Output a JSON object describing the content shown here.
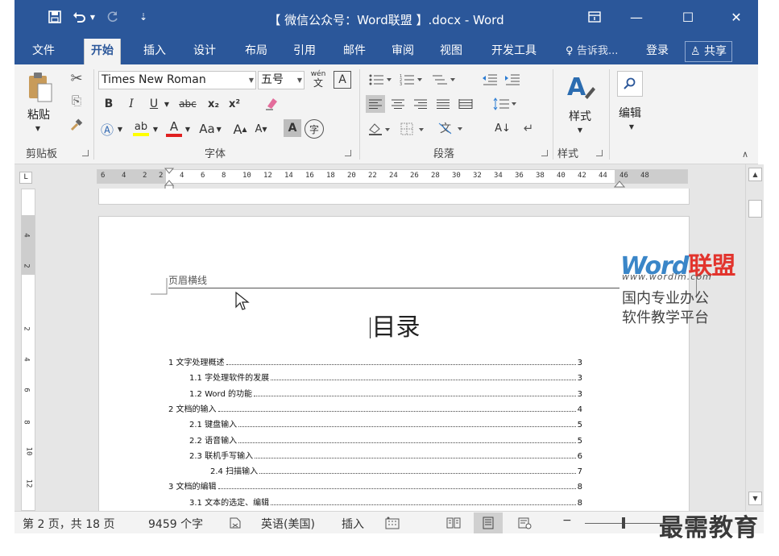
{
  "titlebar": {
    "title": "【 微信公众号：Word联盟 】.docx - Word",
    "save_icon": "save-icon",
    "undo_icon": "undo-icon",
    "redo_icon": "redo-icon",
    "restore_icon": "ribbon-display-icon",
    "minimize": "—",
    "maximize": "☐",
    "close": "✕",
    "bg": "#2b579a"
  },
  "tabs": [
    {
      "label": "文件"
    },
    {
      "label": "开始"
    },
    {
      "label": "插入"
    },
    {
      "label": "设计"
    },
    {
      "label": "布局"
    },
    {
      "label": "引用"
    },
    {
      "label": "邮件"
    },
    {
      "label": "审阅"
    },
    {
      "label": "视图"
    },
    {
      "label": "开发工具"
    }
  ],
  "tellme": "告诉我...",
  "login": "登录",
  "share": "共享",
  "ribbon": {
    "clipboard": {
      "paste": "粘贴",
      "label": "剪贴板"
    },
    "font": {
      "name": "Times New Roman",
      "size": "五号",
      "phonetic": "wén",
      "phonetic_char": "文",
      "box_char": "A",
      "bold": "B",
      "italic": "I",
      "underline": "U",
      "strike": "abc",
      "sub": "x₂",
      "sup": "x²",
      "case": "Aa",
      "grow": "A",
      "shrink": "A",
      "shade": "A",
      "enclose": "字",
      "label": "字体"
    },
    "paragraph": {
      "label": "段落",
      "sort": "A↓"
    },
    "styles": {
      "label": "样式",
      "btn": "样式"
    },
    "editing": {
      "btn": "编辑"
    }
  },
  "ruler": {
    "ticks": [
      "6",
      "4",
      "2",
      "2",
      "4",
      "6",
      "8",
      "10",
      "12",
      "14",
      "16",
      "18",
      "20",
      "22",
      "24",
      "26",
      "28",
      "30",
      "32",
      "34",
      "36",
      "38",
      "40",
      "42",
      "44",
      "46",
      "48"
    ],
    "corner": "L"
  },
  "vruler": {
    "ticks": [
      "4",
      "2",
      "2",
      "4",
      "6",
      "8",
      "10",
      "12"
    ]
  },
  "document": {
    "header_marker": "页眉横线",
    "toc_title": "目录",
    "toc": [
      {
        "text": "1 文字处理概述",
        "page": "3",
        "level": 1
      },
      {
        "text": "1.1 字处理软件的发展",
        "page": "3",
        "level": 2
      },
      {
        "text": "1.2 Word 的功能",
        "page": "3",
        "level": 2
      },
      {
        "text": "2 文档的输入",
        "page": "4",
        "level": 1
      },
      {
        "text": "2.1 键盘输入",
        "page": "5",
        "level": 2
      },
      {
        "text": "2.2 语音输入",
        "page": "5",
        "level": 2
      },
      {
        "text": "2.3 联机手写输入",
        "page": "6",
        "level": 2
      },
      {
        "text": "2.4 扫描输入",
        "page": "7",
        "level": 3
      },
      {
        "text": "3 文档的编辑",
        "page": "8",
        "level": 1
      },
      {
        "text": "3.1 文本的选定、编辑",
        "page": "8",
        "level": 2
      }
    ]
  },
  "watermark": {
    "word": "Word",
    "cn": "联盟",
    "url": "www.wordlm.com",
    "line1": "国内专业办公",
    "line2": "软件教学平台",
    "blue": "#3a86c8",
    "red": "#e2342d"
  },
  "status": {
    "page": "第 2 页，共 18 页",
    "words": "9459 个字",
    "language": "英语(美国)",
    "insert": "插入"
  },
  "brand": "最需教育"
}
